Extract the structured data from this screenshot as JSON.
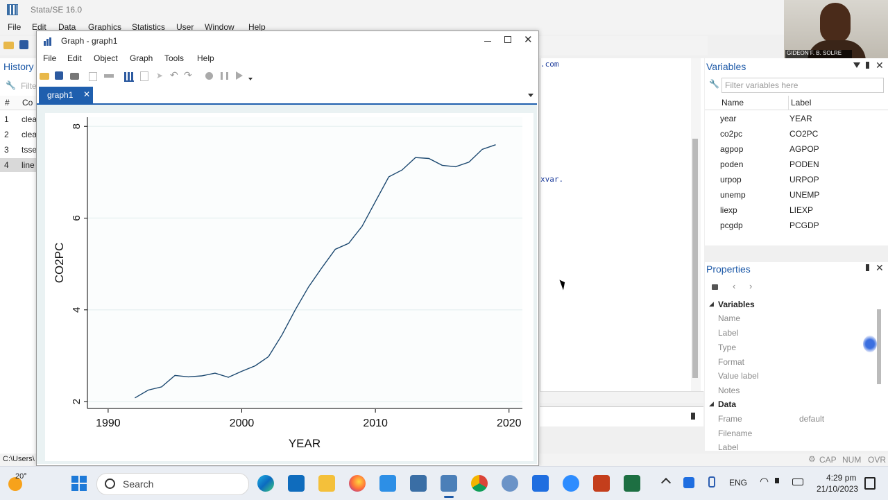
{
  "app": {
    "title": "Stata/SE 16.0",
    "menu": [
      "File",
      "Edit",
      "Data",
      "Graphics",
      "Statistics",
      "User",
      "Window",
      "Help"
    ]
  },
  "history": {
    "title": "History",
    "filter_placeholder": "Filte",
    "col_num": "#",
    "col_cmd": "Co",
    "rows": [
      {
        "n": "1",
        "cmd": "clea"
      },
      {
        "n": "2",
        "cmd": "clea"
      },
      {
        "n": "3",
        "cmd": "tsse"
      },
      {
        "n": "4",
        "cmd": "line"
      }
    ]
  },
  "results": {
    "line1": ".com",
    "line2": "xvar."
  },
  "graph_window": {
    "title": "Graph - graph1",
    "menu": [
      "File",
      "Edit",
      "Object",
      "Graph",
      "Tools",
      "Help"
    ],
    "tab": "graph1"
  },
  "chart_data": {
    "type": "line",
    "xlabel": "YEAR",
    "ylabel": "CO2PC",
    "xlim": [
      1988.5,
      2021
    ],
    "ylim": [
      1.85,
      8.2
    ],
    "xticks": [
      1990,
      2000,
      2010,
      2020
    ],
    "yticks": [
      2,
      4,
      6,
      8
    ],
    "grid": true,
    "series": [
      {
        "x": [
          1992,
          1993,
          1994,
          1995,
          1996,
          1997,
          1998,
          1999,
          2000,
          2001,
          2002,
          2003,
          2004,
          2005,
          2006,
          2007,
          2008,
          2009,
          2010,
          2011,
          2012,
          2013,
          2014,
          2015,
          2016,
          2017,
          2018,
          2019
        ],
        "y": [
          2.08,
          2.25,
          2.32,
          2.57,
          2.54,
          2.56,
          2.62,
          2.53,
          2.66,
          2.78,
          2.98,
          3.45,
          4.0,
          4.5,
          4.92,
          5.32,
          5.45,
          5.82,
          6.36,
          6.9,
          7.05,
          7.32,
          7.3,
          7.15,
          7.12,
          7.22,
          7.5,
          7.6
        ]
      }
    ]
  },
  "variables": {
    "title": "Variables",
    "filter_placeholder": "Filter variables here",
    "col_name": "Name",
    "col_label": "Label",
    "rows": [
      {
        "name": "year",
        "label": "YEAR"
      },
      {
        "name": "co2pc",
        "label": "CO2PC"
      },
      {
        "name": "agpop",
        "label": "AGPOP"
      },
      {
        "name": "poden",
        "label": "PODEN"
      },
      {
        "name": "urpop",
        "label": "URPOP"
      },
      {
        "name": "unemp",
        "label": "UNEMP"
      },
      {
        "name": "liexp",
        "label": "LIEXP"
      },
      {
        "name": "pcgdp",
        "label": "PCGDP"
      }
    ]
  },
  "properties": {
    "title": "Properties",
    "section_vars": "Variables",
    "var_fields": [
      "Name",
      "Label",
      "Type",
      "Format",
      "Value label",
      "Notes"
    ],
    "section_data": "Data",
    "frame_label": "Frame",
    "frame_value": "default",
    "filename_label": "Filename",
    "label_label": "Label"
  },
  "statusbar": {
    "path": "C:\\Users\\",
    "cap": "CAP",
    "num": "NUM",
    "ovr": "OVR"
  },
  "webcam": {
    "caption": "GIDEON F. B. SOLRE"
  },
  "taskbar": {
    "weather": "20°",
    "search": "Search",
    "lang": "ENG",
    "time": "4:29 pm",
    "date": "21/10/2023"
  }
}
